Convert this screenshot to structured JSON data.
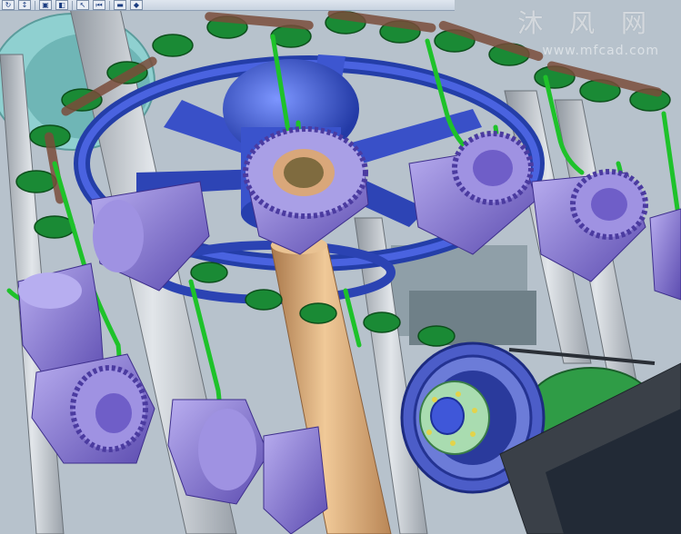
{
  "window": {
    "viewport_label": "3D model view"
  },
  "toolbar": {
    "buttons": [
      {
        "icon": "rotate-view-icon",
        "glyph": "↻"
      },
      {
        "icon": "pan-arrows-icon",
        "glyph": "↕"
      },
      {
        "icon": "standard-views-icon",
        "glyph": "▣"
      },
      {
        "icon": "view-orientation-icon",
        "glyph": "◧"
      },
      {
        "icon": "select-icon",
        "glyph": "↖"
      },
      {
        "icon": "previous-view-icon",
        "glyph": "⏮"
      },
      {
        "icon": "display-style-icon",
        "glyph": "▬"
      },
      {
        "icon": "appearance-icon",
        "glyph": "◆"
      }
    ]
  },
  "watermark": {
    "text": "沐 风 网",
    "url": "www.mfcad.com"
  },
  "colors": {
    "background": "#b7c2cc",
    "gear_purple": "#8a7ad6",
    "chain_green": "#1f8a2f",
    "wheel_blue": "#3e57d6",
    "shaft_tan": "#d7a772",
    "frame_grey": "#c9ced3"
  }
}
